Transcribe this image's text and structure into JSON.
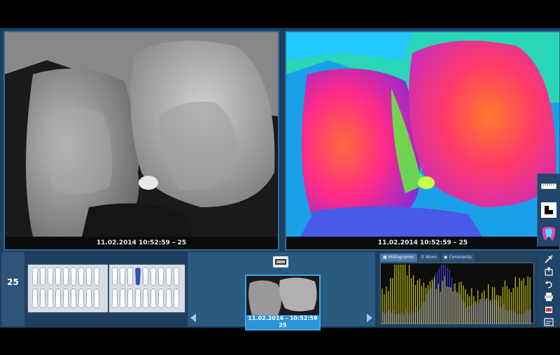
{
  "viewers": {
    "left": {
      "caption": "11.02.2014 10:52:59 – 25",
      "mode": "grayscale"
    },
    "right": {
      "caption": "11.02.2014 10:52:59 – 25",
      "mode": "false-color"
    }
  },
  "side_tools": {
    "icons": [
      "ruler-icon",
      "contrast-icon",
      "color-tooth-icon"
    ]
  },
  "tooth_panel": {
    "selected_tooth": "25"
  },
  "thumbnails": {
    "toolbar_icon": "image-strip-icon",
    "items": [
      {
        "line1": "11.02.2014 - 10:52:59",
        "line2": "25",
        "selected": true
      }
    ]
  },
  "analysis_panel": {
    "tabs": [
      {
        "label": "Histogramm",
        "icon": "histogram-icon",
        "active": true
      },
      {
        "label": "Atom",
        "icon": "zoom-icon",
        "active": false
      },
      {
        "label": "Comments",
        "icon": "comment-icon",
        "active": false
      }
    ],
    "colors": {
      "gray_channel": "#c8c800",
      "blue_channel": "#3b3bd6"
    }
  },
  "right_toolbar": {
    "icons": [
      "tools-icon",
      "export-icon",
      "undo-icon",
      "print-icon",
      "delete-icon",
      "settings-icon"
    ]
  },
  "colors": {
    "accent": "#2f93d8",
    "panel": "#1d3e5e",
    "tooth_selected": "#2f4fb8"
  }
}
